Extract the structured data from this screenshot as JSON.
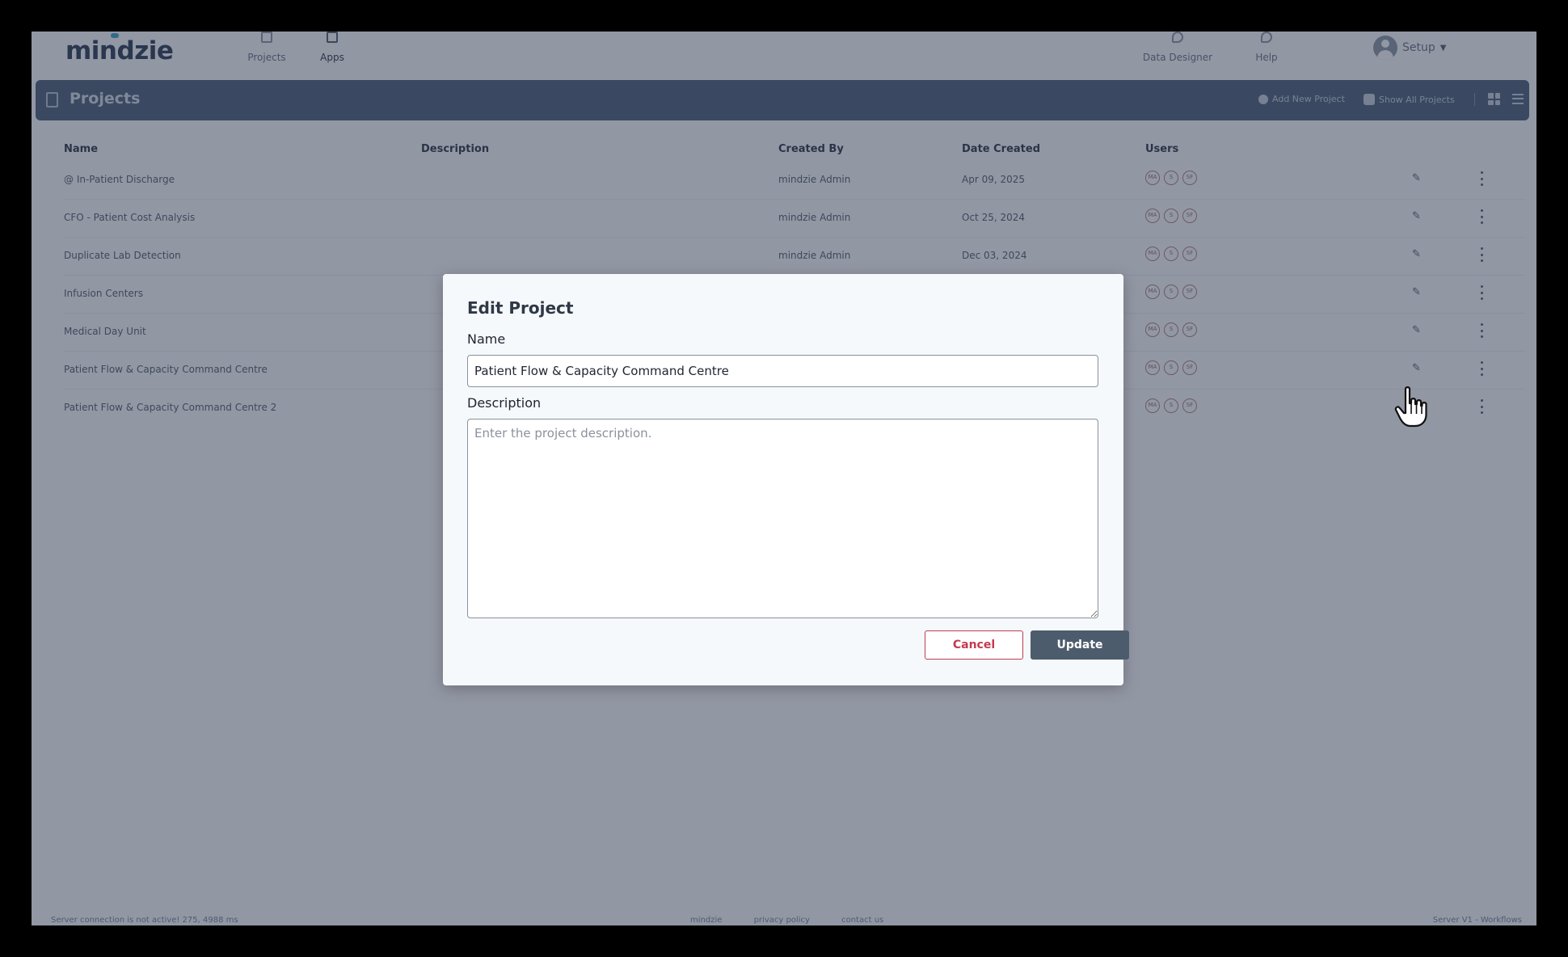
{
  "topbar": {
    "logo": "mindzie",
    "nav": [
      {
        "label": "Projects"
      },
      {
        "label": "Apps"
      },
      {
        "label": "Data Designer"
      },
      {
        "label": "Help"
      }
    ],
    "user_menu": {
      "label": "Setup"
    }
  },
  "page_header": {
    "title": "Projects",
    "add_label": "Add New Project",
    "show_all_label": "Show All Projects"
  },
  "table": {
    "columns": [
      "Name",
      "Description",
      "Created By",
      "Date Created",
      "Users"
    ],
    "rows": [
      {
        "name": "@ In-Patient Discharge",
        "description": "",
        "created_by": "mindzie Admin",
        "date": "Apr 09, 2025",
        "users": [
          "MA",
          "S",
          "SF"
        ]
      },
      {
        "name": "CFO - Patient Cost Analysis",
        "description": "",
        "created_by": "mindzie Admin",
        "date": "Oct 25, 2024",
        "users": [
          "MA",
          "S",
          "SF"
        ]
      },
      {
        "name": "Duplicate Lab Detection",
        "description": "",
        "created_by": "mindzie Admin",
        "date": "Dec 03, 2024",
        "users": [
          "MA",
          "S",
          "SF"
        ]
      },
      {
        "name": "Infusion Centers",
        "description": "",
        "created_by": "",
        "date": "",
        "users": [
          "MA",
          "S",
          "SF"
        ]
      },
      {
        "name": "Medical Day Unit",
        "description": "",
        "created_by": "",
        "date": "",
        "users": [
          "MA",
          "S",
          "SF"
        ]
      },
      {
        "name": "Patient Flow & Capacity Command Centre",
        "description": "",
        "created_by": "",
        "date": "",
        "users": [
          "MA",
          "S",
          "SF"
        ]
      },
      {
        "name": "Patient Flow & Capacity Command Centre 2",
        "description": "",
        "created_by": "",
        "date": "",
        "users": [
          "MA",
          "S",
          "SF"
        ]
      }
    ]
  },
  "footer": {
    "status": "Server connection is not active! 275, 4988 ms",
    "links": [
      "mindzie",
      "privacy policy",
      "contact us"
    ],
    "right": "Server V1 - Workflows"
  },
  "modal": {
    "title": "Edit Project",
    "name_label": "Name",
    "name_value": "Patient Flow & Capacity Command Centre",
    "description_label": "Description",
    "description_placeholder": "Enter the project description.",
    "cancel_label": "Cancel",
    "update_label": "Update"
  },
  "colors": {
    "header_bar": "#4f6378",
    "overlay": "#262f4a",
    "cancel": "#c23a50",
    "update": "#4d5c6c"
  }
}
